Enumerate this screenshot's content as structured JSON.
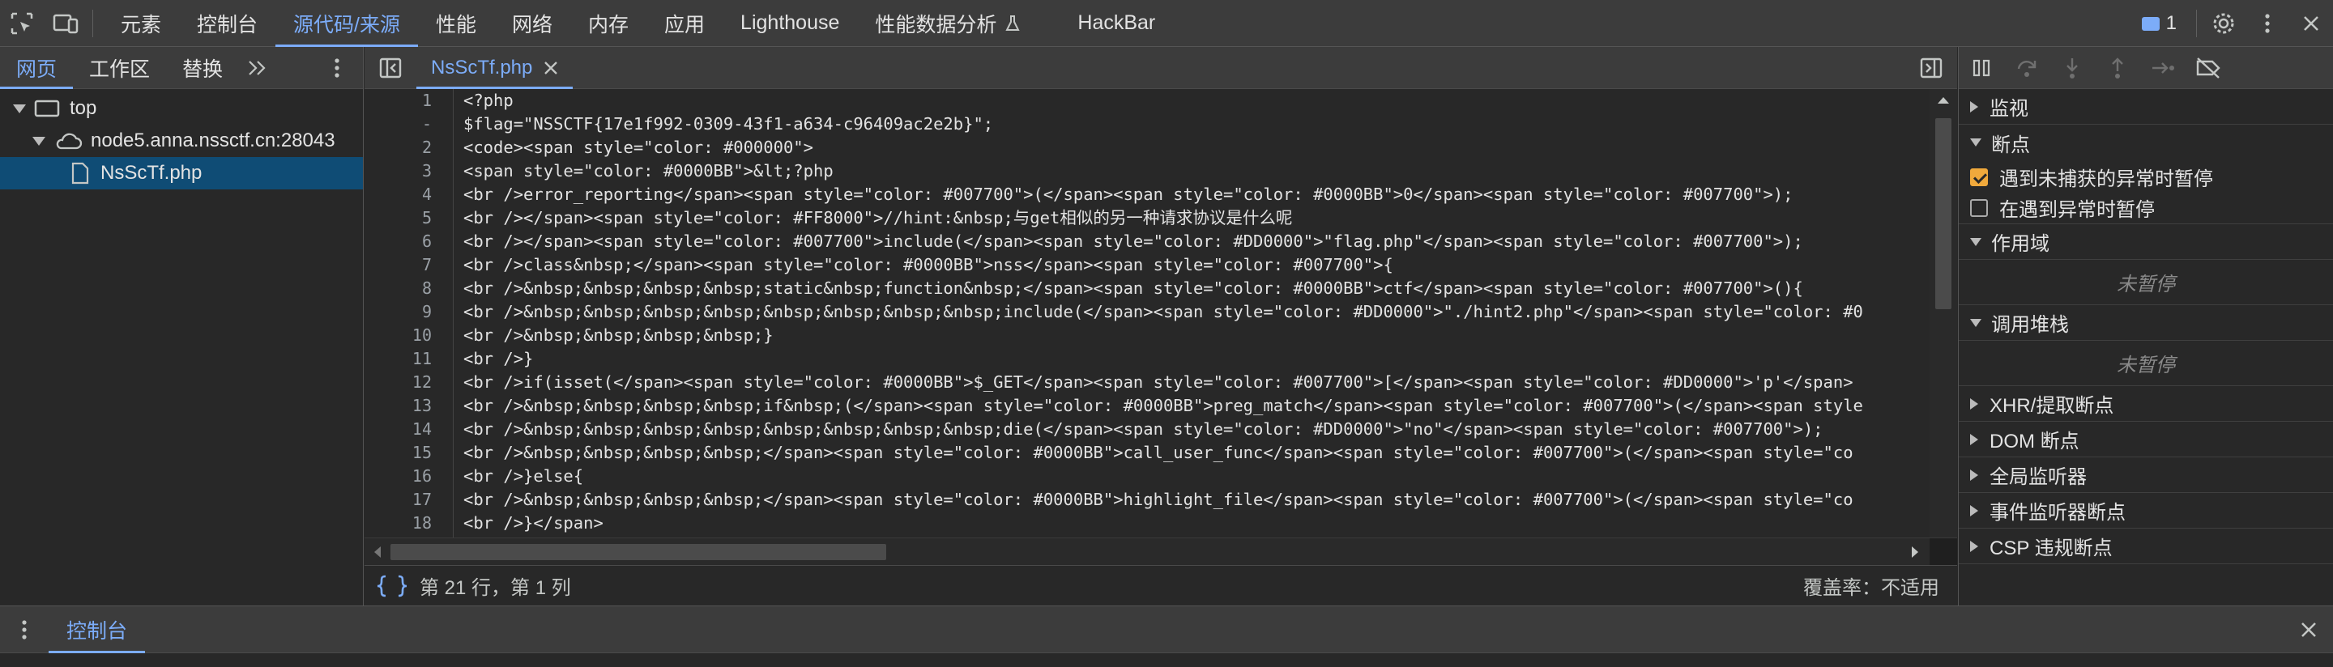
{
  "main_tabs": [
    "元素",
    "控制台",
    "源代码/来源",
    "性能",
    "网络",
    "内存",
    "应用",
    "Lighthouse",
    "性能数据分析",
    "HackBar"
  ],
  "issues_count": "1",
  "navigator": {
    "tabs": [
      "网页",
      "工作区",
      "替换"
    ],
    "tree": {
      "top": "top",
      "host": "node5.anna.nssctf.cn:28043",
      "file": "NsScTf.php"
    }
  },
  "editor": {
    "file_tab": "NsScTf.php",
    "line_numbers": [
      "1",
      "-",
      "2",
      "3",
      "4",
      "5",
      "6",
      "7",
      "8",
      "9",
      "10",
      "11",
      "12",
      "13",
      "14",
      "15",
      "16",
      "17",
      "18"
    ],
    "lines": [
      "<?php",
      "$flag=\"NSSCTF{17e1f992-0309-43f1-a634-c96409ac2e2b}\";",
      "<code><span style=\"color: #000000\">",
      "<span style=\"color: #0000BB\">&lt;?php",
      "<br />error_reporting</span><span style=\"color: #007700\">(</span><span style=\"color: #0000BB\">0</span><span style=\"color: #007700\">);",
      "<br /></span><span style=\"color: #FF8000\">//hint:&nbsp;与get相似的另一种请求协议是什么呢",
      "<br /></span><span style=\"color: #007700\">include(</span><span style=\"color: #DD0000\">\"flag.php\"</span><span style=\"color: #007700\">);",
      "<br />class&nbsp;</span><span style=\"color: #0000BB\">nss</span><span style=\"color: #007700\">{",
      "<br />&nbsp;&nbsp;&nbsp;&nbsp;static&nbsp;function&nbsp;</span><span style=\"color: #0000BB\">ctf</span><span style=\"color: #007700\">(){",
      "<br />&nbsp;&nbsp;&nbsp;&nbsp;&nbsp;&nbsp;&nbsp;&nbsp;include(</span><span style=\"color: #DD0000\">\"./hint2.php\"</span><span style=\"color: #0",
      "<br />&nbsp;&nbsp;&nbsp;&nbsp;}",
      "<br />}",
      "<br />if(isset(</span><span style=\"color: #0000BB\">$_GET</span><span style=\"color: #007700\">[</span><span style=\"color: #DD0000\">'p'</span>",
      "<br />&nbsp;&nbsp;&nbsp;&nbsp;if&nbsp;(</span><span style=\"color: #0000BB\">preg_match</span><span style=\"color: #007700\">(</span><span style",
      "<br />&nbsp;&nbsp;&nbsp;&nbsp;&nbsp;&nbsp;&nbsp;&nbsp;die(</span><span style=\"color: #DD0000\">\"no\"</span><span style=\"color: #007700\">);",
      "<br />&nbsp;&nbsp;&nbsp;&nbsp;</span><span style=\"color: #0000BB\">call_user_func</span><span style=\"color: #007700\">(</span><span style=\"co",
      "<br />}else{",
      "<br />&nbsp;&nbsp;&nbsp;&nbsp;</span><span style=\"color: #0000BB\">highlight_file</span><span style=\"color: #007700\">(</span><span style=\"co",
      "<br />}</span>"
    ],
    "status_position": "第 21 行，第 1 列",
    "coverage": "覆盖率：不适用"
  },
  "debugger": {
    "watch": "监视",
    "breakpoints": "断点",
    "pause_uncaught": "遇到未捕获的异常时暂停",
    "pause_caught": "在遇到异常时暂停",
    "scope": "作用域",
    "scope_status": "未暂停",
    "call_stack": "调用堆栈",
    "call_stack_status": "未暂停",
    "xhr": "XHR/提取断点",
    "dom": "DOM 断点",
    "global": "全局监听器",
    "event": "事件监听器断点",
    "csp": "CSP 违规断点"
  },
  "drawer": {
    "tab": "控制台"
  },
  "colors": {
    "accent": "#7cacf8",
    "tag": "#5db0d7",
    "attr": "#9bbbdc",
    "string": "#f29766",
    "checkbox": "#f0a93c",
    "selection": "#0f4c75"
  }
}
